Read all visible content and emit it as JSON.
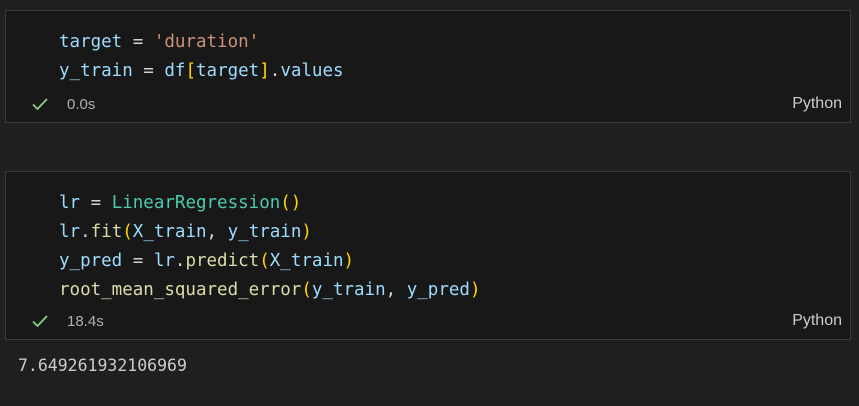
{
  "cells": [
    {
      "id": "cell-1",
      "lines": [
        [
          {
            "t": "target",
            "c": "var"
          },
          {
            "t": " = ",
            "c": "op"
          },
          {
            "t": "'duration'",
            "c": "str"
          }
        ],
        [
          {
            "t": "y_train",
            "c": "var"
          },
          {
            "t": " = ",
            "c": "op"
          },
          {
            "t": "df",
            "c": "var"
          },
          {
            "t": "[",
            "c": "br1"
          },
          {
            "t": "target",
            "c": "var"
          },
          {
            "t": "]",
            "c": "br1"
          },
          {
            "t": ".",
            "c": "punct"
          },
          {
            "t": "values",
            "c": "var"
          }
        ]
      ],
      "status": {
        "icon": "check-icon",
        "time": "0.0s"
      },
      "language": "Python"
    },
    {
      "id": "cell-2",
      "lines": [
        [
          {
            "t": "lr",
            "c": "var"
          },
          {
            "t": " = ",
            "c": "op"
          },
          {
            "t": "LinearRegression",
            "c": "class"
          },
          {
            "t": "()",
            "c": "br1"
          }
        ],
        [
          {
            "t": "lr",
            "c": "var"
          },
          {
            "t": ".",
            "c": "punct"
          },
          {
            "t": "fit",
            "c": "fn"
          },
          {
            "t": "(",
            "c": "br1"
          },
          {
            "t": "X_train",
            "c": "var"
          },
          {
            "t": ", ",
            "c": "punct"
          },
          {
            "t": "y_train",
            "c": "var"
          },
          {
            "t": ")",
            "c": "br1"
          }
        ],
        [
          {
            "t": "y_pred",
            "c": "var"
          },
          {
            "t": " = ",
            "c": "op"
          },
          {
            "t": "lr",
            "c": "var"
          },
          {
            "t": ".",
            "c": "punct"
          },
          {
            "t": "predict",
            "c": "fn"
          },
          {
            "t": "(",
            "c": "br1"
          },
          {
            "t": "X_train",
            "c": "var"
          },
          {
            "t": ")",
            "c": "br1"
          }
        ],
        [
          {
            "t": "root_mean_squared_error",
            "c": "fn"
          },
          {
            "t": "(",
            "c": "br1"
          },
          {
            "t": "y_train",
            "c": "var"
          },
          {
            "t": ", ",
            "c": "punct"
          },
          {
            "t": "y_pred",
            "c": "var"
          },
          {
            "t": ")",
            "c": "br1"
          }
        ]
      ],
      "status": {
        "icon": "check-icon",
        "time": "18.4s"
      },
      "language": "Python",
      "output": "7.649261932106969"
    }
  ],
  "colors": {
    "background": "#1f1f1f",
    "cell_background": "#181818",
    "cell_border": "#3a3a3a",
    "success_check": "#89d185"
  }
}
